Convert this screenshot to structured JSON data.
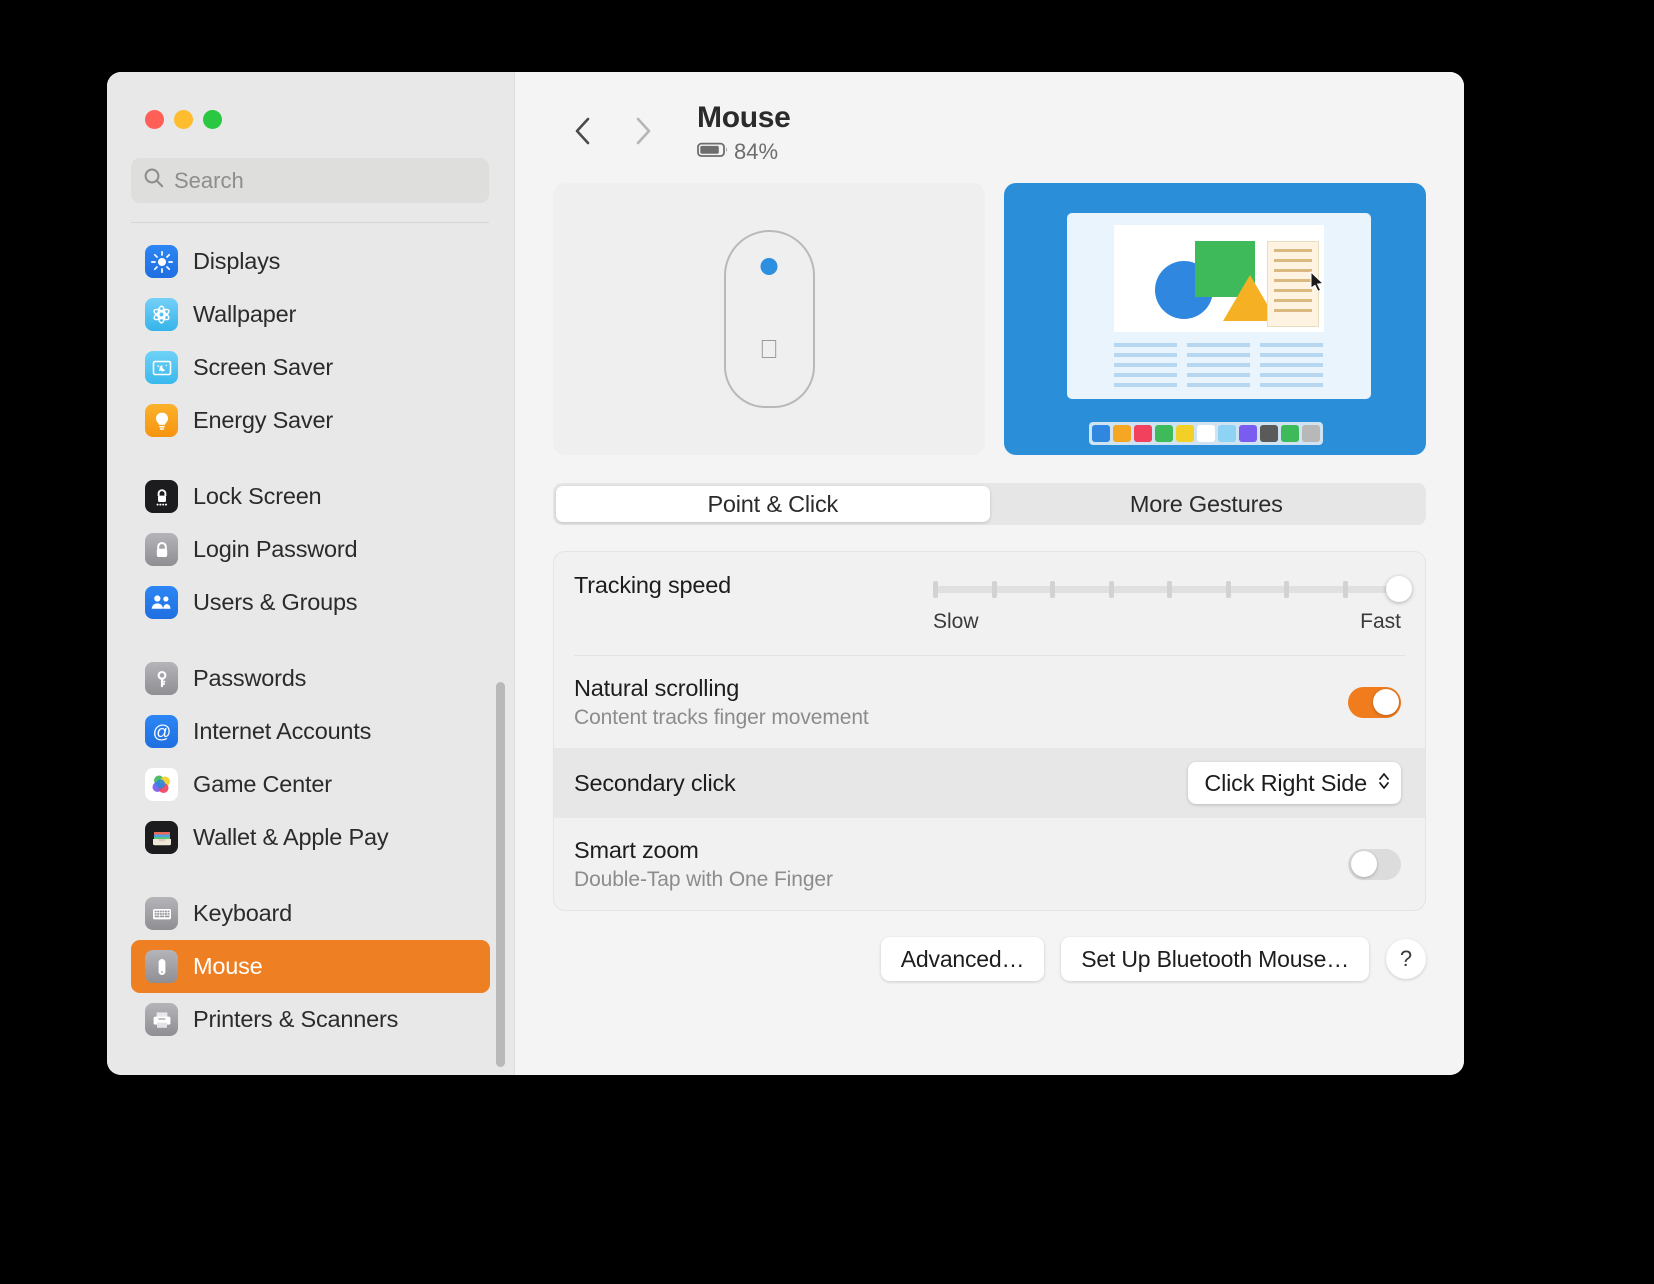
{
  "window": {
    "traffic_lights": [
      "close",
      "minimize",
      "maximize"
    ]
  },
  "sidebar": {
    "search": {
      "placeholder": "Search",
      "icon": "search-icon"
    },
    "groups": [
      {
        "items": [
          {
            "label": "Displays",
            "icon": "displays-icon",
            "selected": false
          },
          {
            "label": "Wallpaper",
            "icon": "wallpaper-icon",
            "selected": false
          },
          {
            "label": "Screen Saver",
            "icon": "screen-saver-icon",
            "selected": false
          },
          {
            "label": "Energy Saver",
            "icon": "energy-saver-icon",
            "selected": false
          }
        ]
      },
      {
        "items": [
          {
            "label": "Lock Screen",
            "icon": "lock-screen-icon",
            "selected": false
          },
          {
            "label": "Login Password",
            "icon": "login-password-icon",
            "selected": false
          },
          {
            "label": "Users & Groups",
            "icon": "users-groups-icon",
            "selected": false
          }
        ]
      },
      {
        "items": [
          {
            "label": "Passwords",
            "icon": "passwords-key-icon",
            "selected": false
          },
          {
            "label": "Internet Accounts",
            "icon": "internet-accounts-at-icon",
            "selected": false
          },
          {
            "label": "Game Center",
            "icon": "game-center-icon",
            "selected": false
          },
          {
            "label": "Wallet & Apple Pay",
            "icon": "wallet-icon",
            "selected": false
          }
        ]
      },
      {
        "items": [
          {
            "label": "Keyboard",
            "icon": "keyboard-icon",
            "selected": false
          },
          {
            "label": "Mouse",
            "icon": "mouse-icon",
            "selected": true
          },
          {
            "label": "Printers & Scanners",
            "icon": "printers-scanners-icon",
            "selected": false
          }
        ]
      }
    ]
  },
  "header": {
    "back_icon": "chevron-left-icon",
    "forward_icon": "chevron-right-icon",
    "title": "Mouse",
    "battery_icon": "battery-icon",
    "battery_percent": "84%"
  },
  "hero": {
    "device_preview": "magic-mouse-illustration",
    "gesture_preview": "gesture-animation-preview"
  },
  "tabs": [
    {
      "label": "Point & Click",
      "active": true
    },
    {
      "label": "More Gestures",
      "active": false
    }
  ],
  "settings": {
    "tracking_speed": {
      "label": "Tracking speed",
      "min_label": "Slow",
      "max_label": "Fast",
      "ticks": 9,
      "value": 9,
      "value_percent": 100
    },
    "natural_scrolling": {
      "label": "Natural scrolling",
      "sublabel": "Content tracks finger movement",
      "toggle_state": "on"
    },
    "secondary_click": {
      "label": "Secondary click",
      "value": "Click Right Side",
      "chevron_icon": "chevron-up-down-icon",
      "row_highlighted": true
    },
    "smart_zoom": {
      "label": "Smart zoom",
      "sublabel": "Double-Tap with One Finger",
      "toggle_state": "off"
    }
  },
  "footer": {
    "advanced_label": "Advanced…",
    "bluetooth_label": "Set Up Bluetooth Mouse…",
    "help_label": "?"
  },
  "colors": {
    "accent_orange": "#ee8023",
    "toggle_on": "#f07c1e",
    "gesture_bg": "#2a8fd8",
    "sidebar_bg": "#e8e8e8",
    "main_bg": "#f4f4f4"
  },
  "gesture_swatches": [
    "#2f87e0",
    "#f5a623",
    "#f2415c",
    "#3fba5a",
    "#f2d027",
    "#ffffff",
    "#8fd3f4",
    "#7a5cf0",
    "#5a5a5a",
    "#3fba5a",
    "#b8b8b8"
  ]
}
